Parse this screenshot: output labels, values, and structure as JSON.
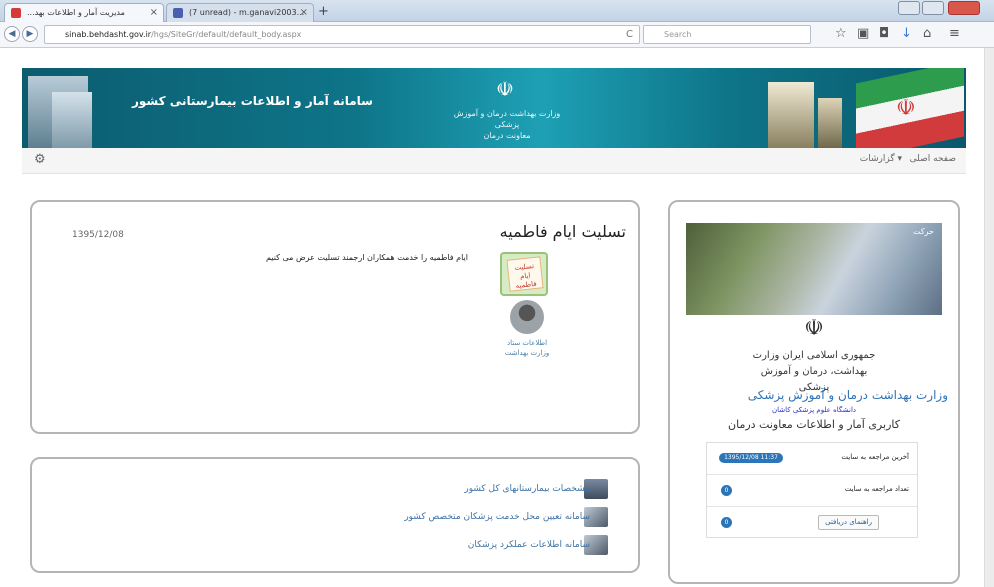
{
  "browser": {
    "tabs": [
      {
        "title": "...مدیریت آمار و اطلاعات بهد"
      },
      {
        "title": "(7 unread) - m.ganavi2003..."
      }
    ],
    "new_tab_symbol": "+",
    "close_symbol": "×",
    "url_host": "sinab.behdasht.gov.ir",
    "url_path": "/hgs/SiteGr/default/default_body.aspx",
    "search_placeholder": "Search",
    "reload_symbol": "C"
  },
  "banner": {
    "system_title": "سامانه آمار و اطلاعات بیمارستانی کشور",
    "ministry_line1": "وزارت بهداشت درمان و آموزش پزشکی",
    "ministry_line2": "معاونت درمان"
  },
  "nav": {
    "home": "صفحه اصلی",
    "reports": "گزارشات ▾"
  },
  "news": {
    "date": "1395/12/08",
    "title": "تسلیت ایام فاطمیه",
    "text": "ایام فاطمیه را خدمت همکاران ارجمند تسلیت عرض می کنیم",
    "image_caption": "تسلیت ایام فاطمیه",
    "author": "اطلاعات ستاد وزارت بهداشت"
  },
  "links": [
    {
      "label": "مشخصات بیمارستانهای کل کشور"
    },
    {
      "label": "سامانه تعیین محل خدمت پزشکان متخصص کشور"
    },
    {
      "label": "سامانه اطلاعات عملکرد پزشکان"
    }
  ],
  "sidebar": {
    "photo_tag": "حرکت",
    "calligraphy": "جمهوری اسلامی ایران وزارت بهداشت، درمان و آموزش پزشکی",
    "ministry": "وزارت بهداشت درمان و آموزش پزشکی",
    "university": "دانشگاه علوم پزشکی کاشان",
    "department": "کاربری آمار و اطلاعات معاونت درمان",
    "last_visit_label": "آخرین مراجعه به سایت",
    "last_visit_value": "1395/12/08 11:37",
    "visit_count_label": "تعداد مراجعه به سایت",
    "visit_count_value": "0",
    "guide_button": "راهنمای دریافتی",
    "guide_value": "0"
  },
  "colors": {
    "banner_teal": "#0e7488",
    "link_blue": "#3e73a6",
    "ministry_blue": "#2f74b5",
    "badge_blue": "#2b75b8"
  }
}
